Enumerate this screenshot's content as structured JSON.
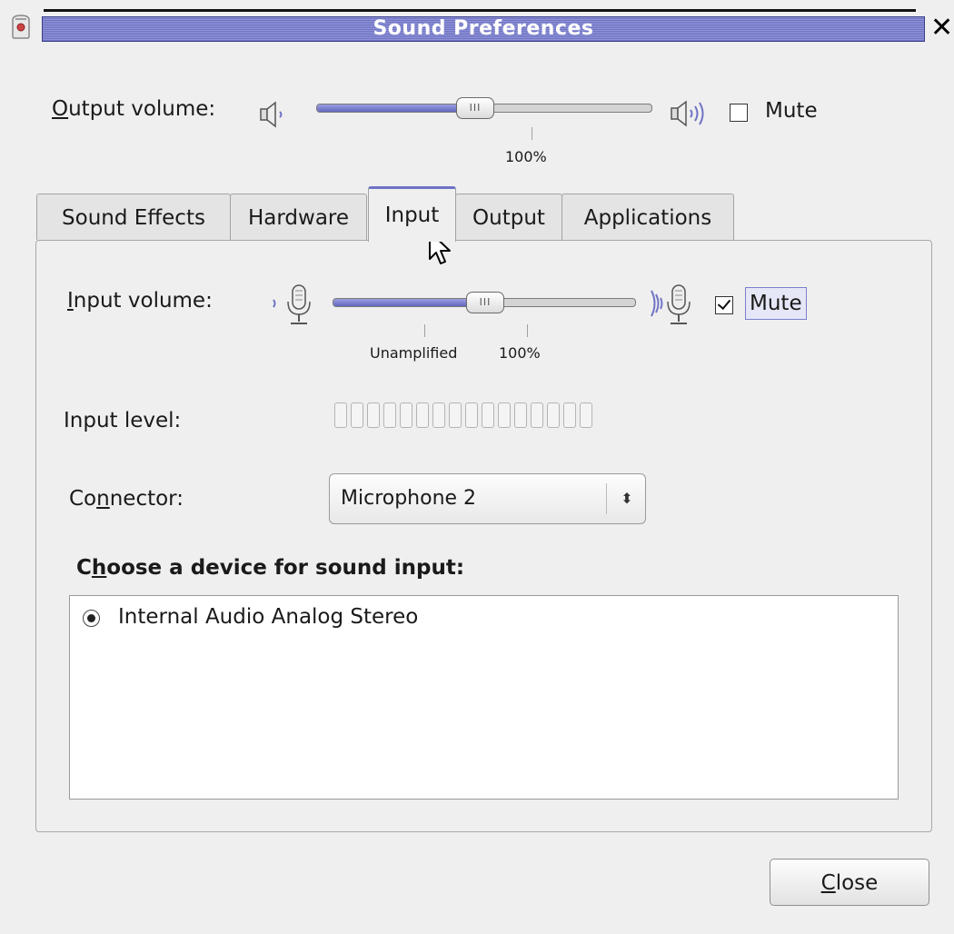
{
  "window": {
    "title": "Sound Preferences",
    "close_glyph": "✕"
  },
  "output": {
    "label_mnemonic": "O",
    "label_rest": "utput volume:",
    "volume_percent": 100,
    "volume_fraction": 0.47,
    "tick_label": "100%",
    "mute_label": "Mute",
    "muted": false,
    "low_icon": "speaker-low-icon",
    "high_icon": "speaker-high-icon"
  },
  "tabs": [
    {
      "label": "Sound Effects",
      "active": false
    },
    {
      "label": "Hardware",
      "active": false
    },
    {
      "label": "Input",
      "active": true
    },
    {
      "label": "Output",
      "active": false
    },
    {
      "label": "Applications",
      "active": false
    }
  ],
  "input": {
    "label_mnemonic": "I",
    "label_rest": "nput volume:",
    "volume_fraction": 0.5,
    "tick_labels": [
      "Unamplified",
      "100%"
    ],
    "mute_label": "Mute",
    "muted": true,
    "level_label": "Input level:",
    "level_segments": 16,
    "level_value": 0,
    "low_icon": "microphone-low-icon",
    "high_icon": "microphone-high-icon"
  },
  "connector": {
    "label_pre": "Co",
    "label_mnemonic": "n",
    "label_post": "nector:",
    "value": "Microphone 2",
    "arrow_glyph": "⬍"
  },
  "device_section": {
    "heading_pre": "C",
    "heading_mnemonic": "h",
    "heading_post": "oose a device for sound input:",
    "devices": [
      {
        "name": "Internal Audio Analog Stereo",
        "selected": true
      }
    ]
  },
  "close_button": {
    "mnemonic": "C",
    "rest": "lose"
  },
  "colors": {
    "accent": "#6f73c4",
    "title_bar": "#7b7fcc",
    "window_bg": "#efefef"
  }
}
